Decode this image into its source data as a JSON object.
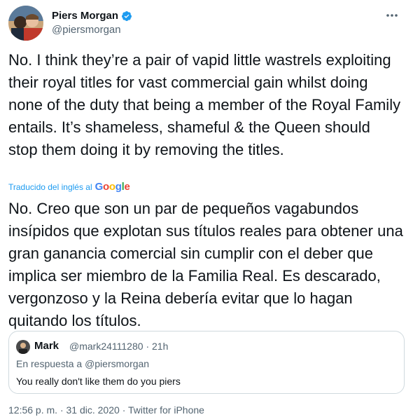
{
  "author": {
    "display_name": "Piers Morgan",
    "handle": "@piersmorgan",
    "verified": true
  },
  "tweet": {
    "text": "No. I think they’re a pair of vapid little wastrels exploiting their royal titles for vast commercial gain whilst doing none of the duty that being a member of the Royal Family entails. It’s shameless, shameful & the Queen should stop them doing it by removing the titles.",
    "translated_by_label": "Traducido del inglés al",
    "translation_provider": "Google",
    "translated_text": "No. Creo que son un par de pequeños vagabundos insípidos que explotan sus títulos reales para obtener una gran ganancia comercial sin cumplir con el deber que implica ser miembro de la Familia Real. Es descarado, vergonzoso y la Reina debería evitar que lo hagan quitando los títulos."
  },
  "quoted_tweet": {
    "display_name": "Mark",
    "handle": "@mark24111280",
    "separator": "·",
    "time": "21h",
    "reply_prefix": "En respuesta a",
    "reply_to": "@piersmorgan",
    "text": "You really don't like them do you piers"
  },
  "footer": {
    "time": "12:56 p. m.",
    "date": "31 dic. 2020",
    "source": "Twitter for iPhone",
    "separator": "·"
  },
  "colors": {
    "link": "#1d9bf0",
    "secondary_text": "#536471",
    "primary_text": "#0f1419",
    "border": "#cfd9de"
  },
  "icons": {
    "verified": "verified-badge-icon",
    "more": "more-options-icon"
  }
}
